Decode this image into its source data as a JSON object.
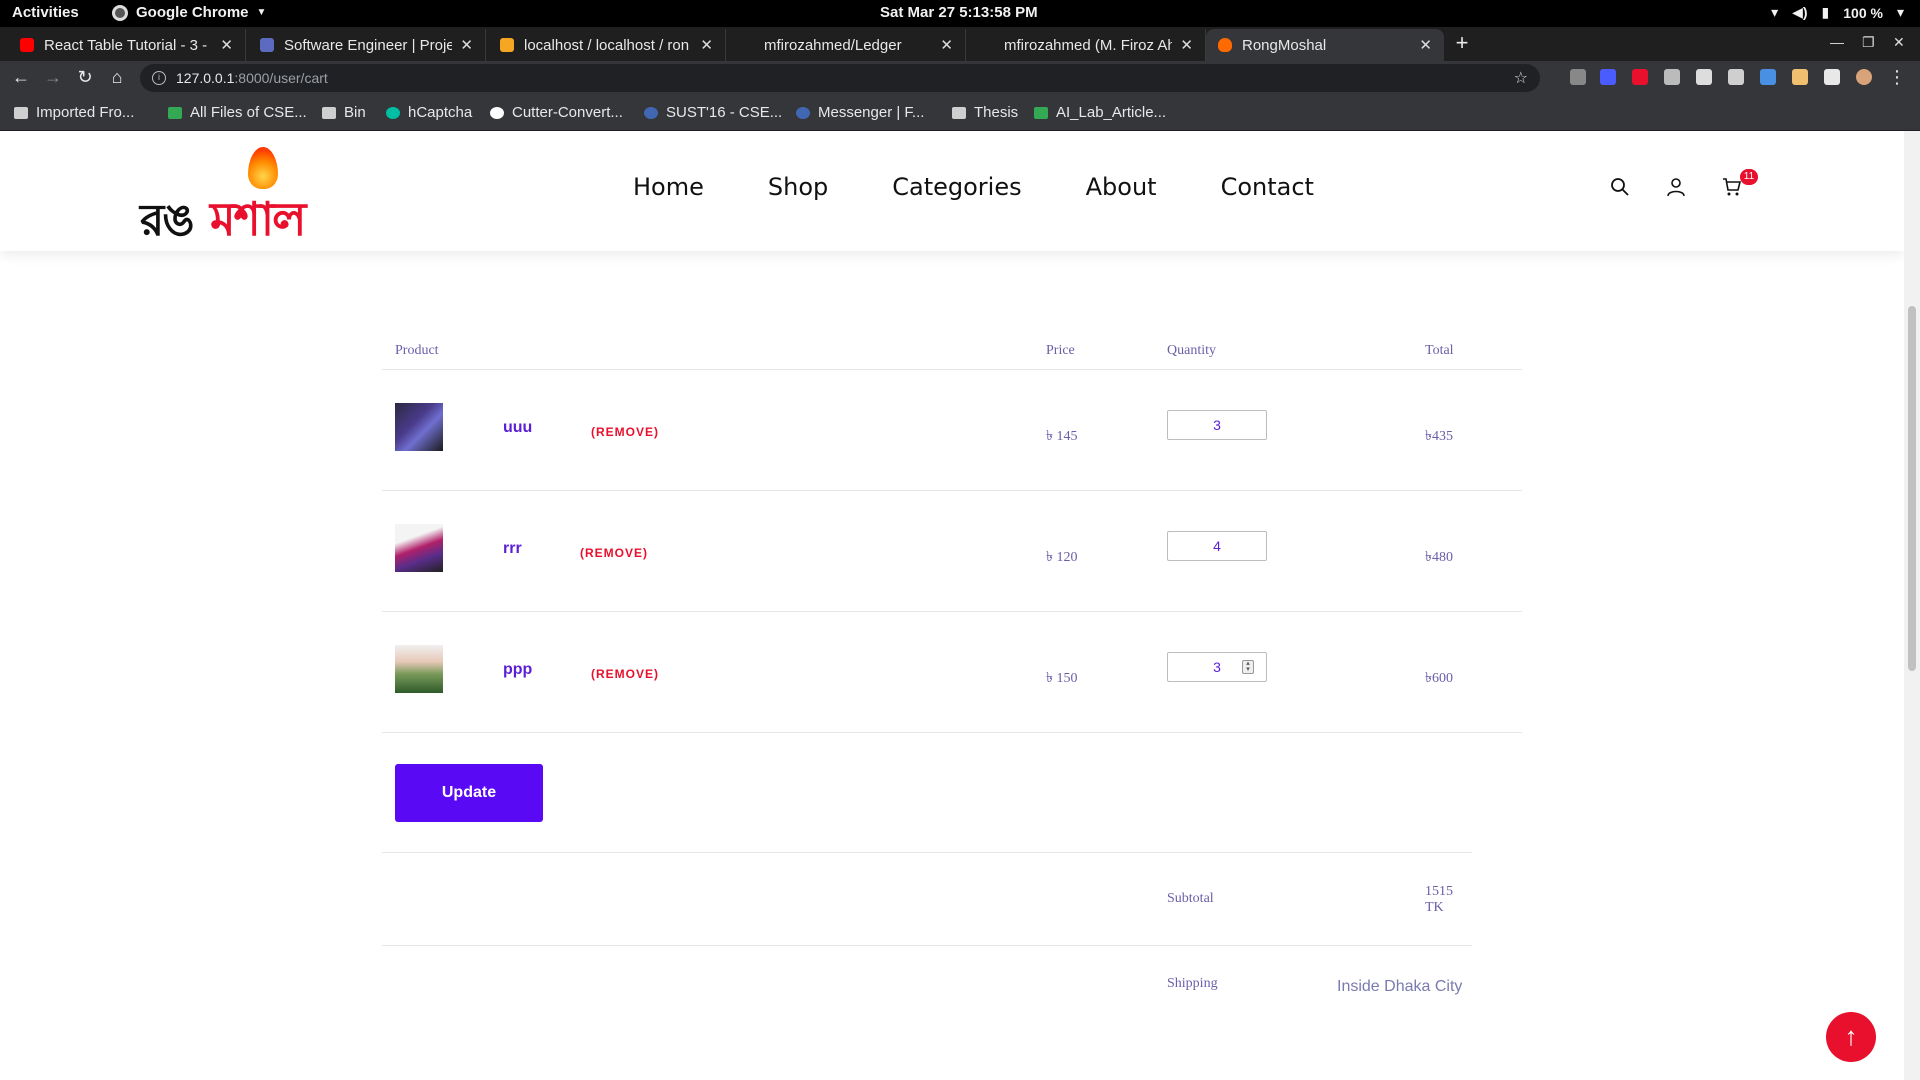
{
  "os": {
    "activities": "Activities",
    "app_name": "Google Chrome",
    "clock": "Sat Mar 27   5:13:58 PM",
    "battery": "100 %"
  },
  "tabs": [
    {
      "title": "React Table Tutorial - 3 - E",
      "color": "#ff0000"
    },
    {
      "title": "Software Engineer | Proje",
      "color": "#5c6bc0"
    },
    {
      "title": "localhost / localhost / ron",
      "color": "#f5a623"
    },
    {
      "title": "mfirozahmed/Ledger",
      "color": "#1f1f1f"
    },
    {
      "title": "mfirozahmed (M. Firoz Ah",
      "color": "#1f1f1f"
    },
    {
      "title": "RongMoshal",
      "color": "#ff6a00",
      "active": true
    }
  ],
  "address": {
    "host": "127.0.0.1",
    "path": ":8000/user/cart"
  },
  "bookmarks": [
    {
      "label": "Imported Fro...",
      "color": "#cfcfcf"
    },
    {
      "label": "All Files of CSE...",
      "color": "#34a853"
    },
    {
      "label": "Bin",
      "color": "#cfcfcf"
    },
    {
      "label": "hCaptcha",
      "color": "#00bfa5"
    },
    {
      "label": "Cutter-Convert...",
      "color": "#ffffff"
    },
    {
      "label": "SUST'16 - CSE...",
      "color": "#4267b2"
    },
    {
      "label": "Messenger | F...",
      "color": "#4267b2"
    },
    {
      "label": "Thesis",
      "color": "#cfcfcf"
    },
    {
      "label": "AI_Lab_Article...",
      "color": "#34a853"
    }
  ],
  "site": {
    "logo_part1": "রঙ",
    "logo_part2": "মশাল",
    "nav": [
      "Home",
      "Shop",
      "Categories",
      "About",
      "Contact"
    ],
    "cart_count": "11"
  },
  "cart": {
    "headers": {
      "product": "Product",
      "price": "Price",
      "quantity": "Quantity",
      "total": "Total"
    },
    "remove_label": "(REMOVE)",
    "items": [
      {
        "name": "uuu",
        "price": "৳ 145",
        "qty": "3",
        "total": "৳435",
        "thumb_color": "#4a3a8a"
      },
      {
        "name": "rrr",
        "price": "৳ 120",
        "qty": "4",
        "total": "৳480",
        "thumb_color": "#b0206a"
      },
      {
        "name": "ppp",
        "price": "৳ 150",
        "qty": "3",
        "total": "৳600",
        "thumb_color": "#4c7a3a"
      }
    ],
    "update_label": "Update",
    "subtotal_label": "Subtotal",
    "subtotal_value": "1515 TK",
    "shipping_label": "Shipping",
    "shipping_option": "Inside Dhaka City"
  },
  "colors": {
    "brand_red": "#e8102c",
    "accent_purple": "#5a09f5"
  }
}
